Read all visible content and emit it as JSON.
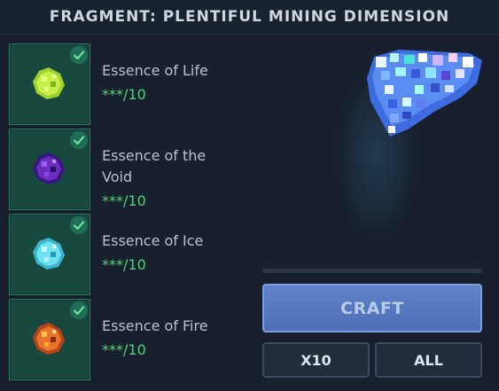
{
  "header": {
    "title": "FRAGMENT: PLENTIFUL MINING DIMENSION"
  },
  "ingredients": [
    {
      "name": "Essence of Life",
      "count": "***/10",
      "icon": "life-essence-icon",
      "color": "#b8e63a",
      "checked": true
    },
    {
      "name": "Essence of the Void",
      "count": "***/10",
      "icon": "void-essence-icon",
      "color": "#6a2fc0",
      "checked": true
    },
    {
      "name": "Essence of Ice",
      "count": "***/10",
      "icon": "ice-essence-icon",
      "color": "#5fd8ea",
      "checked": true
    },
    {
      "name": "Essence of Fire",
      "count": "***/10",
      "icon": "fire-essence-icon",
      "color": "#e8762a",
      "checked": true
    }
  ],
  "preview": {
    "icon": "dimension-fragment-icon"
  },
  "progress": {
    "fraction": 0
  },
  "actions": {
    "craft_label": "CRAFT",
    "x10_label": "X10",
    "all_label": "ALL"
  },
  "colors": {
    "accent": "#4fd17e",
    "craft": "#5879c0",
    "slot": "#18493f"
  }
}
